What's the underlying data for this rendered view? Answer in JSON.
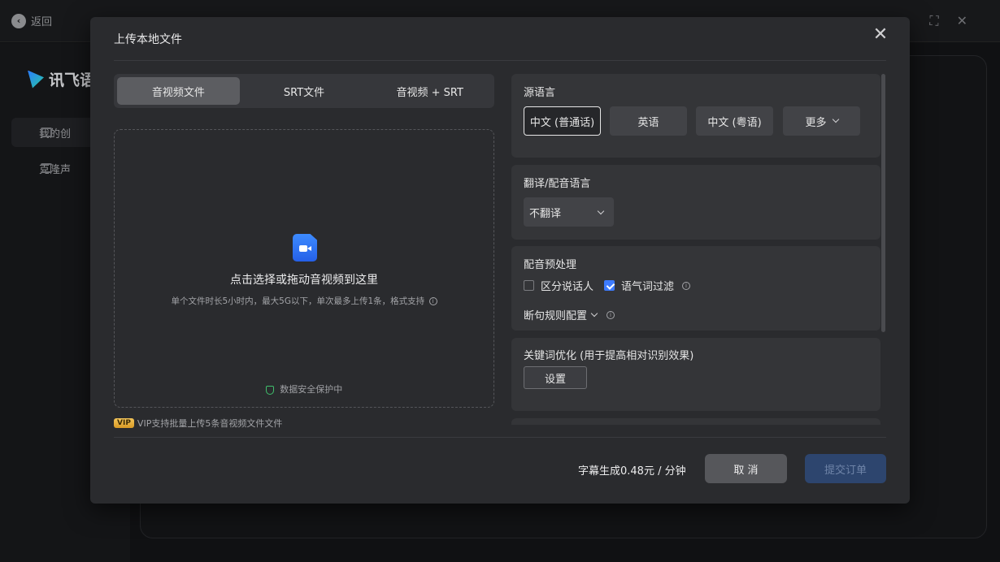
{
  "background": {
    "back_label": "返回",
    "logo_text": "讯飞语",
    "side_items": [
      "我的创",
      "克隆声"
    ]
  },
  "modal": {
    "title": "上传本地文件",
    "close_glyph": "✕",
    "tabs": [
      "音视频文件",
      "SRT文件",
      "音视频 + SRT"
    ],
    "active_tab": 0,
    "drop": {
      "main": "点击选择或拖动音视频到这里",
      "sub": "单个文件时长5小时内，最大5G以下，单次最多上传1条，格式支持",
      "safe": "数据安全保护中"
    },
    "vip": {
      "badge": "VIP",
      "text": "VIP支持批量上传5条音视频文件文件"
    },
    "source_language": {
      "title": "源语言",
      "options": [
        "中文 (普通话)",
        "英语",
        "中文 (粤语)",
        "更多"
      ],
      "selected": 0
    },
    "translate": {
      "title": "翻译/配音语言",
      "value": "不翻译"
    },
    "preprocess": {
      "title": "配音预处理",
      "speaker_label": "区分说话人",
      "speaker_checked": false,
      "filler_label": "语气词过滤",
      "filler_checked": true,
      "rule_label": "断句规则配置"
    },
    "keywords": {
      "title": "关键词优化 (用于提高相对识别效果)",
      "button": "设置"
    },
    "footer": {
      "price": "字幕生成0.48元 / 分钟",
      "cancel": "取 消",
      "submit": "提交订单"
    }
  },
  "colors": {
    "accent": "#3d7bff",
    "modal_bg": "#2a2b2e",
    "card_bg": "#343538",
    "submit_disabled": "#2d456e"
  }
}
